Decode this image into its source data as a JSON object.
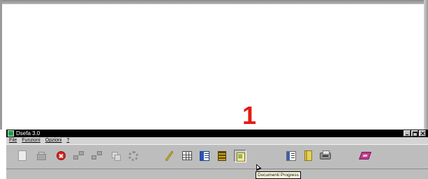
{
  "overlay": {
    "step_number": "1"
  },
  "window": {
    "title": "Dsefa 3.0"
  },
  "menu": [
    {
      "label": "File"
    },
    {
      "label": "Funzioni"
    },
    {
      "label": "Opzioni"
    },
    {
      "label": "?"
    }
  ],
  "toolbar": {
    "tools": [
      {
        "icon": "new-document-icon"
      },
      {
        "icon": "open-folder-icon"
      },
      {
        "icon": "stop-icon"
      },
      {
        "icon": "network-connect-icon"
      },
      {
        "icon": "network-disconnect-icon"
      },
      {
        "icon": "copy-icon"
      },
      {
        "icon": "settings-gear-icon"
      },
      {
        "icon": "pen-icon"
      },
      {
        "icon": "grid-table-icon"
      },
      {
        "icon": "form-icon"
      },
      {
        "icon": "book-stack-icon"
      },
      {
        "icon": "documents-progress-icon"
      },
      {
        "icon": "list-view-icon"
      },
      {
        "icon": "notebook-icon"
      },
      {
        "icon": "printer-icon"
      },
      {
        "icon": "pink-book-icon"
      }
    ]
  },
  "tooltip": {
    "text": "Documenti Progress"
  },
  "colors": {
    "step_number": "#e41b10",
    "titlebar": "#000000",
    "toolbar": "#bdbdbd",
    "tooltip_bg": "#ffffe1"
  }
}
